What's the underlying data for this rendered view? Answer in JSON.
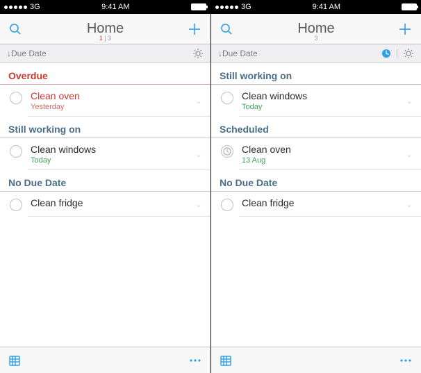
{
  "status": {
    "carrier": "3G",
    "time": "9:41 AM"
  },
  "left": {
    "title": "Home",
    "count_overdue": "1",
    "count_sep": " | ",
    "count_total": "3",
    "sort": "Due Date",
    "sections": {
      "overdue": "Overdue",
      "working": "Still working on",
      "nodate": "No Due Date"
    },
    "tasks": {
      "oven": {
        "title": "Clean oven",
        "sub": "Yesterday"
      },
      "windows": {
        "title": "Clean windows",
        "sub": "Today"
      },
      "fridge": {
        "title": "Clean fridge"
      }
    }
  },
  "right": {
    "title": "Home",
    "count_total": "3",
    "sort": "Due Date",
    "sections": {
      "working": "Still working on",
      "scheduled": "Scheduled",
      "nodate": "No Due Date"
    },
    "tasks": {
      "windows": {
        "title": "Clean windows",
        "sub": "Today"
      },
      "oven": {
        "title": "Clean oven",
        "sub": "13 Aug"
      },
      "fridge": {
        "title": "Clean fridge"
      }
    }
  }
}
